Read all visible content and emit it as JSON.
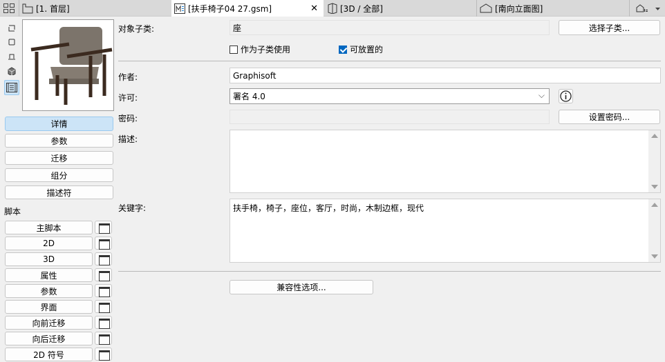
{
  "tabs": [
    {
      "label": "[1. 首层]"
    },
    {
      "label": "[扶手椅子04 27.gsm]",
      "active": true
    },
    {
      "label": "[3D / 全部]"
    },
    {
      "label": "[南向立面图]"
    }
  ],
  "left": {
    "nav": [
      "详情",
      "参数",
      "迁移",
      "组分",
      "描述符"
    ],
    "script_heading": "脚本",
    "scripts": [
      "主脚本",
      "2D",
      "3D",
      "属性",
      "参数",
      "界面",
      "向前迁移",
      "向后迁移",
      "2D 符号"
    ]
  },
  "form": {
    "subtype_label": "对象子类:",
    "subtype_value": "座",
    "select_subtype": "选择子类...",
    "use_as_subtype": "作为子类使用",
    "placeable": "可放置的",
    "author_label": "作者:",
    "author_value": "Graphisoft",
    "license_label": "许可:",
    "license_value": "署名 4.0",
    "password_label": "密码:",
    "set_password": "设置密码...",
    "description_label": "描述:",
    "description_value": "",
    "keywords_label": "关键字:",
    "keywords_value": "扶手椅，椅子，座位，客厅，时尚，木制边框，现代",
    "compat": "兼容性选项..."
  },
  "colors": {
    "accent": "#0067c0",
    "selected": "#cce4f7"
  }
}
